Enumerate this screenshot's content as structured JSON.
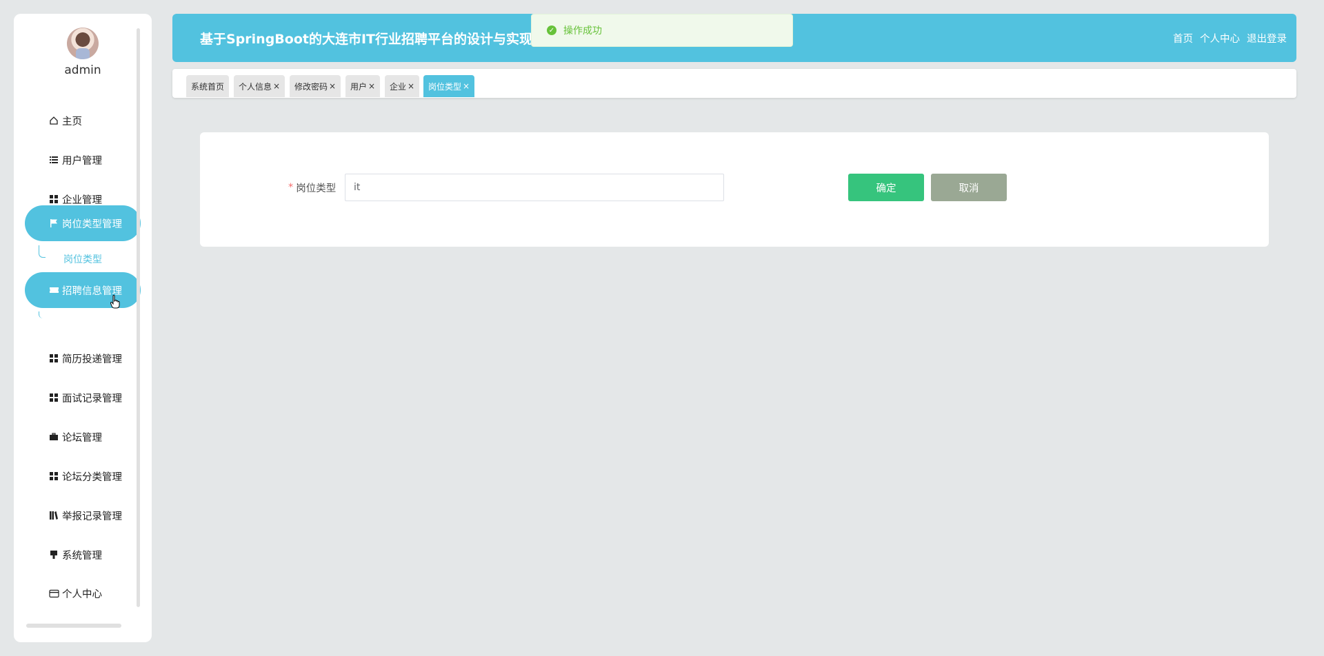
{
  "user": {
    "name": "admin"
  },
  "header": {
    "title": "基于SpringBoot的大连市IT行业招聘平台的设计与实现",
    "nav": {
      "home": "首页",
      "profile": "个人中心",
      "logout": "退出登录"
    }
  },
  "toast": {
    "message": "操作成功",
    "type": "success"
  },
  "sidebar": {
    "items": [
      {
        "label": "主页",
        "icon": "home-icon"
      },
      {
        "label": "用户管理",
        "icon": "list-icon"
      },
      {
        "label": "企业管理",
        "icon": "grid-icon"
      },
      {
        "label": "岗位类型管理",
        "icon": "flag-icon"
      },
      {
        "label": "招聘信息管理",
        "icon": "ticket-icon"
      },
      {
        "label": "简历投递管理",
        "icon": "grid-icon"
      },
      {
        "label": "面试记录管理",
        "icon": "grid-icon"
      },
      {
        "label": "论坛管理",
        "icon": "briefcase-icon"
      },
      {
        "label": "论坛分类管理",
        "icon": "grid-icon"
      },
      {
        "label": "举报记录管理",
        "icon": "books-icon"
      },
      {
        "label": "系统管理",
        "icon": "brush-icon"
      },
      {
        "label": "个人中心",
        "icon": "card-icon"
      }
    ],
    "subitems": {
      "job_type": "岗位类型"
    }
  },
  "tabs": [
    {
      "label": "系统首页",
      "closable": false
    },
    {
      "label": "个人信息",
      "closable": true
    },
    {
      "label": "修改密码",
      "closable": true
    },
    {
      "label": "用户",
      "closable": true
    },
    {
      "label": "企业",
      "closable": true
    },
    {
      "label": "岗位类型",
      "closable": true,
      "active": true
    }
  ],
  "form": {
    "field_label": "岗位类型",
    "field_value": "it",
    "confirm_label": "确定",
    "cancel_label": "取消"
  },
  "colors": {
    "accent": "#52c2df",
    "confirm": "#36c47d",
    "cancel": "#9aa894",
    "success": "#67c23a"
  }
}
